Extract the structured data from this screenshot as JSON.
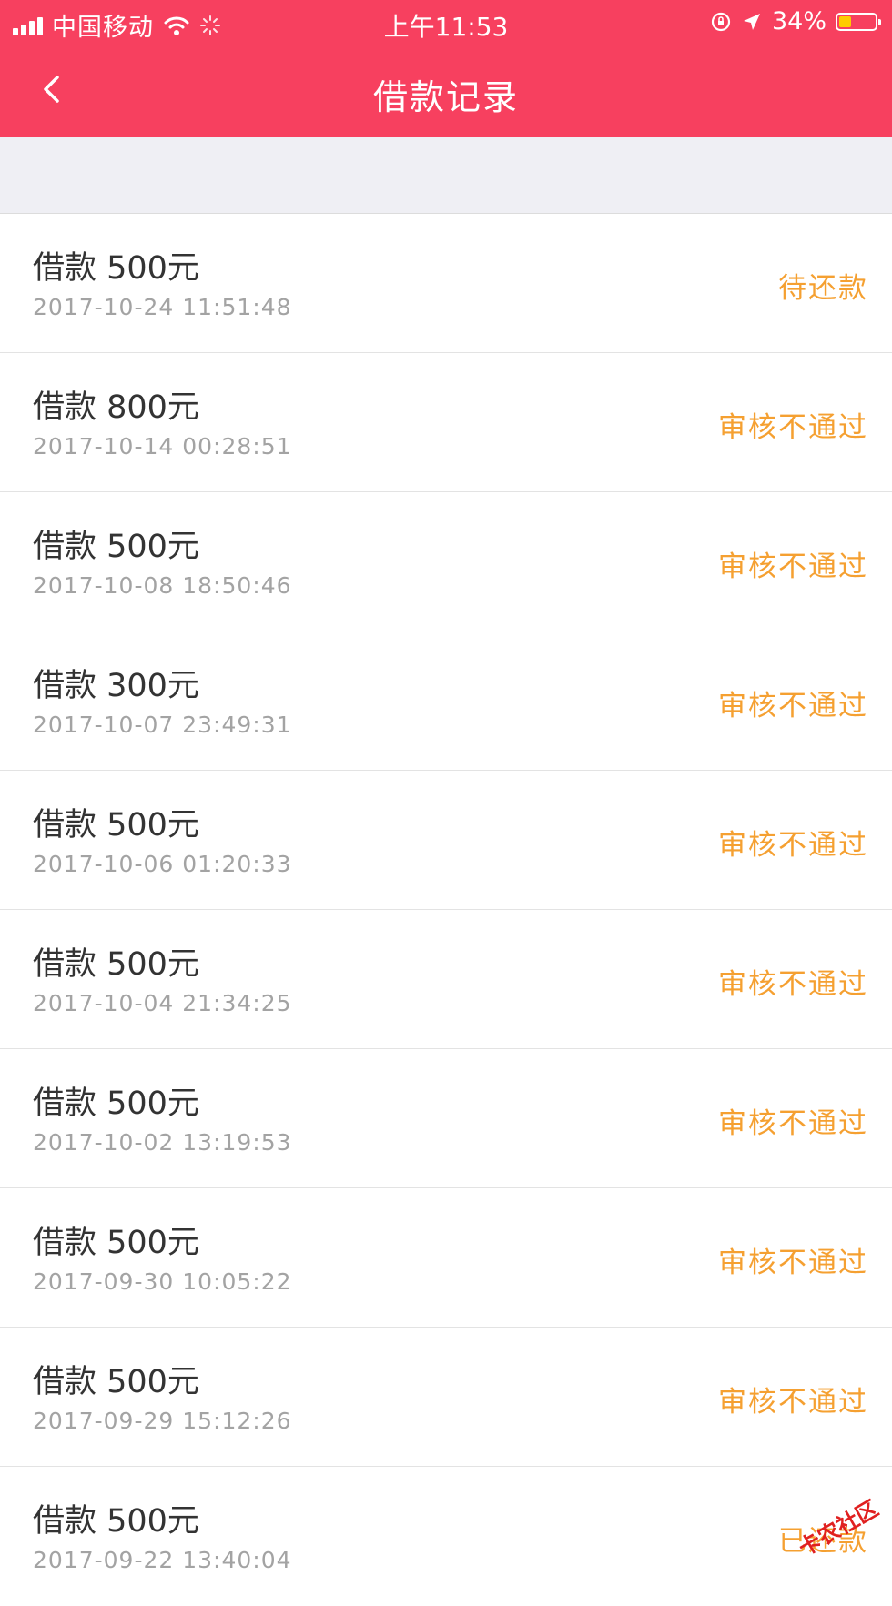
{
  "status_bar": {
    "carrier": "中国移动",
    "time": "上午11:53",
    "battery": "34%",
    "battery_level": 0.34,
    "icons": [
      "signal-icon",
      "wifi-icon",
      "loading-icon",
      "orientation-lock-icon",
      "location-icon",
      "battery-icon"
    ]
  },
  "nav": {
    "title": "借款记录",
    "back_icon": "back-chevron-icon"
  },
  "colors": {
    "header": "#f7405f",
    "status_text": "#f5a031",
    "background": "#efeff4"
  },
  "records": [
    {
      "amount": "借款 500元",
      "time": "2017-10-24 11:51:48",
      "status": "待还款"
    },
    {
      "amount": "借款 800元",
      "time": "2017-10-14 00:28:51",
      "status": "审核不通过"
    },
    {
      "amount": "借款 500元",
      "time": "2017-10-08 18:50:46",
      "status": "审核不通过"
    },
    {
      "amount": "借款 300元",
      "time": "2017-10-07 23:49:31",
      "status": "审核不通过"
    },
    {
      "amount": "借款 500元",
      "time": "2017-10-06 01:20:33",
      "status": "审核不通过"
    },
    {
      "amount": "借款 500元",
      "time": "2017-10-04 21:34:25",
      "status": "审核不通过"
    },
    {
      "amount": "借款 500元",
      "time": "2017-10-02 13:19:53",
      "status": "审核不通过"
    },
    {
      "amount": "借款 500元",
      "time": "2017-09-30 10:05:22",
      "status": "审核不通过"
    },
    {
      "amount": "借款 500元",
      "time": "2017-09-29 15:12:26",
      "status": "审核不通过"
    },
    {
      "amount": "借款 500元",
      "time": "2017-09-22 13:40:04",
      "status": "已还款"
    }
  ],
  "watermark": "卡农社区"
}
